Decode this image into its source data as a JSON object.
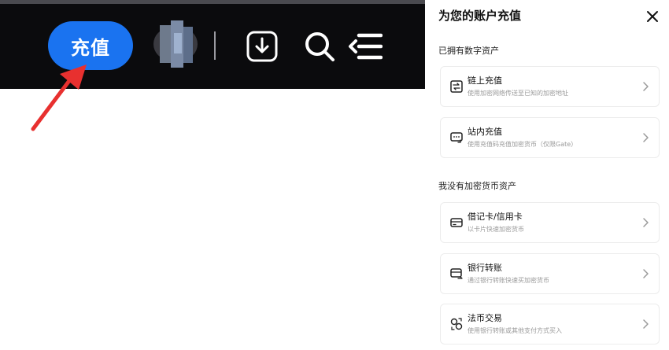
{
  "navbar": {
    "deposit_label": "充值"
  },
  "panel": {
    "title": "为您的账户充值",
    "section_have_crypto": "已拥有数字资产",
    "section_no_crypto": "我没有加密货币资产",
    "items": [
      {
        "title": "链上充值",
        "subtitle": "使用加密网络传送至已知的加密地址",
        "icon": "chain-deposit-icon"
      },
      {
        "title": "站内充值",
        "subtitle": "使用充值码充值加密货币（仅限Gate）",
        "icon": "internal-deposit-icon"
      },
      {
        "title": "借记卡/信用卡",
        "subtitle": "以卡片快速加密货币",
        "icon": "card-icon"
      },
      {
        "title": "银行转账",
        "subtitle": "通过银行转账快速买加密货币",
        "icon": "bank-transfer-icon"
      },
      {
        "title": "法币交易",
        "subtitle": "使用银行转账或其他支付方式买入",
        "icon": "fiat-trade-icon"
      }
    ]
  },
  "colors": {
    "navbar_bg": "#0b0b0d",
    "deposit_button": "#1a73f0",
    "annotation_arrow": "#e8302f"
  }
}
